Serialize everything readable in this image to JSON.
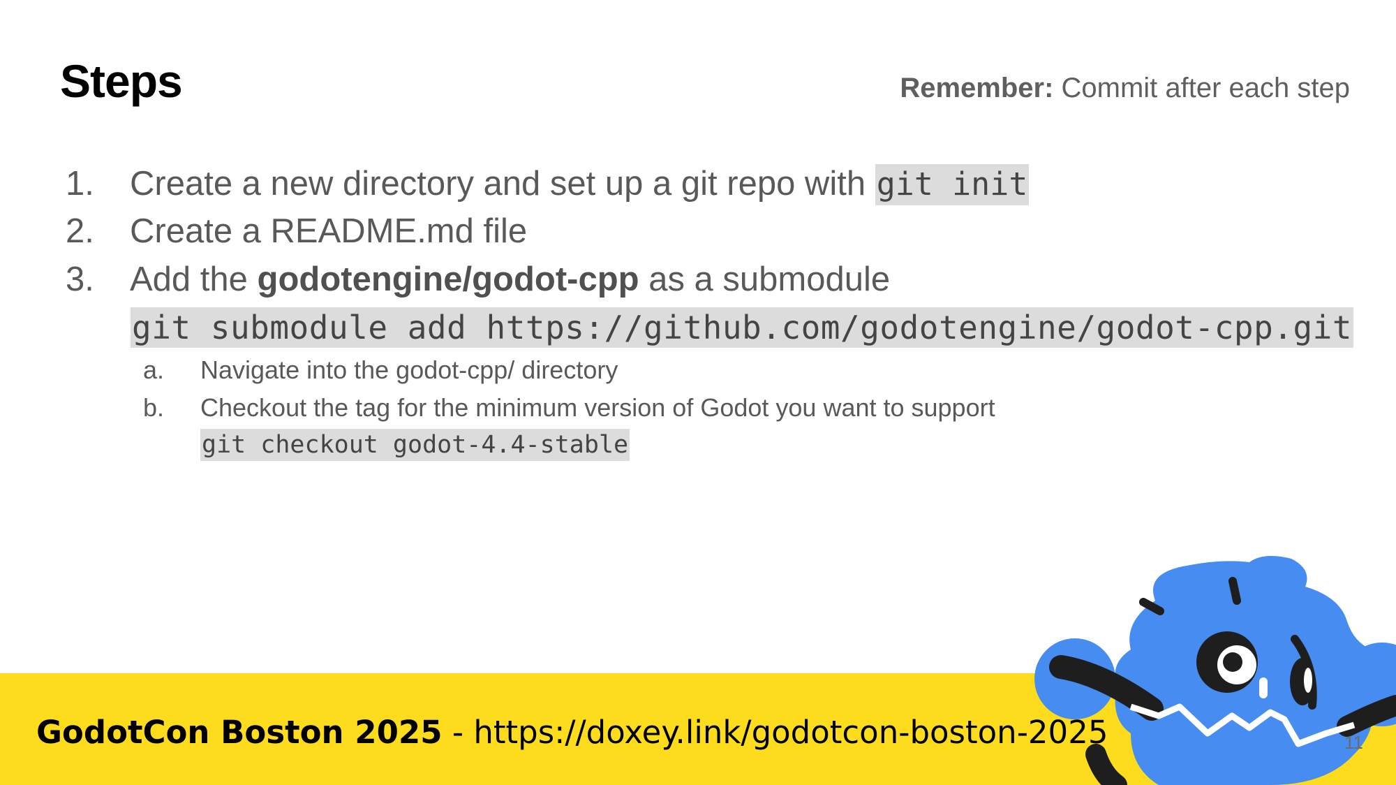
{
  "title": "Steps",
  "reminder": {
    "label": "Remember:",
    "text": " Commit after each step"
  },
  "steps": [
    {
      "num": "1.",
      "text": "Create a new directory and set up a git repo with ",
      "code": "git init"
    },
    {
      "num": "2.",
      "text": "Create a README.md file"
    },
    {
      "num": "3.",
      "text_before": "Add the ",
      "bold": "godotengine/godot-cpp",
      "text_after": " as a submodule",
      "code": "git submodule add https://github.com/godotengine/godot-cpp.git"
    }
  ],
  "substeps": [
    {
      "num": "a.",
      "text": "Navigate into the godot-cpp/ directory"
    },
    {
      "num": "b.",
      "text": "Checkout the tag for the minimum version of Godot you want to support",
      "code": "git checkout godot-4.4-stable"
    }
  ],
  "footer": {
    "event": "GodotCon Boston 2025",
    "separator": " - ",
    "link": "https://doxey.link/godotcon-boston-2025"
  },
  "page_number": "11",
  "colors": {
    "footer_bg": "#fddc1e",
    "mascot_blue": "#478cf0",
    "code_bg": "#dcdcdc"
  },
  "mascot": "godot-robot-mascot"
}
